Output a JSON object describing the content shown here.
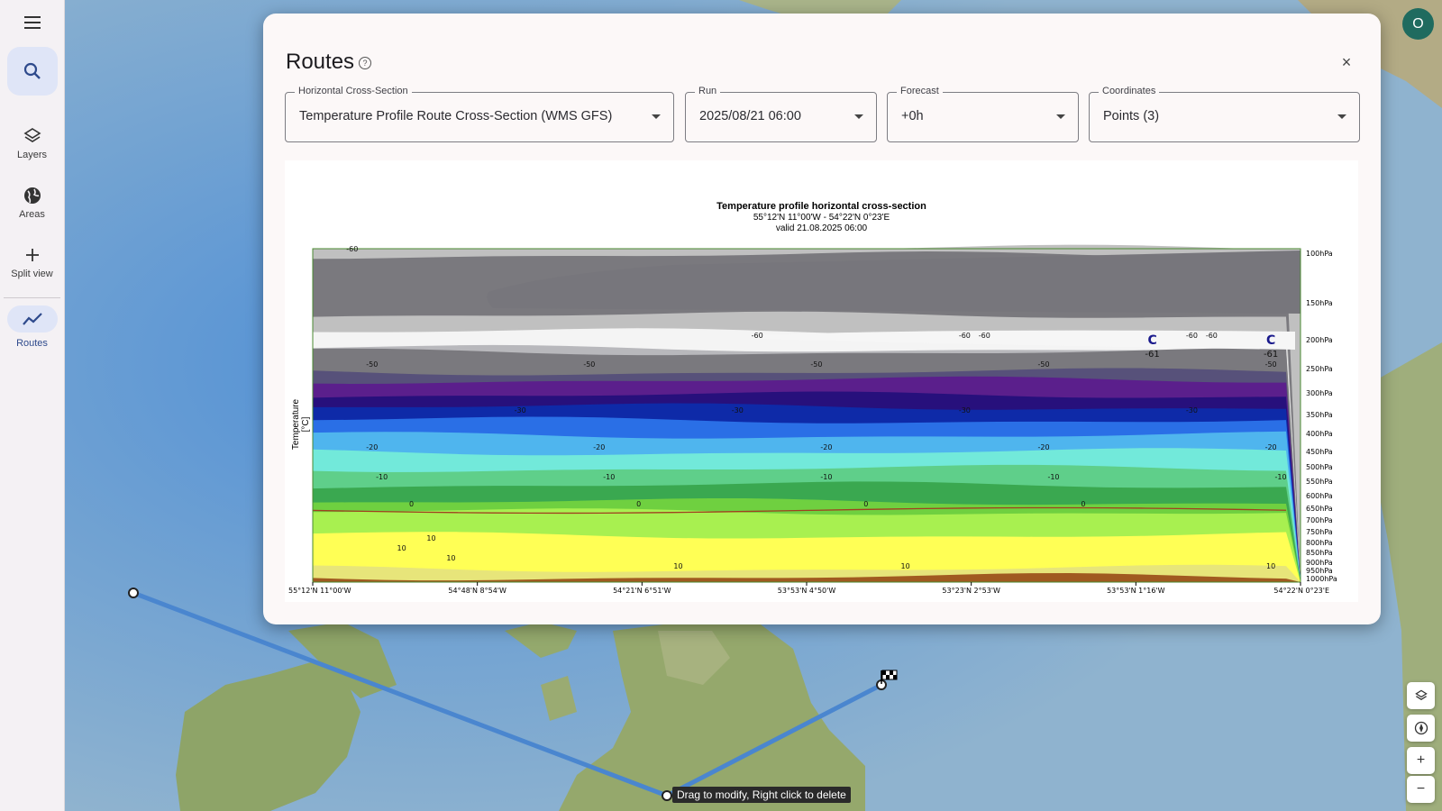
{
  "sidebar": {
    "items": [
      {
        "label": "Layers",
        "icon": "layers-icon"
      },
      {
        "label": "Areas",
        "icon": "globe-icon"
      },
      {
        "label": "Split view",
        "icon": "plus-icon"
      },
      {
        "label": "Routes",
        "icon": "route-chart-icon"
      }
    ]
  },
  "dialog": {
    "title": "Routes",
    "help_glyph": "?",
    "close_glyph": "×",
    "fields": [
      {
        "label": "Horizontal Cross-Section",
        "value": "Temperature Profile Route Cross-Section (WMS GFS)"
      },
      {
        "label": "Run",
        "value": "2025/08/21 06:00"
      },
      {
        "label": "Forecast",
        "value": "+0h"
      },
      {
        "label": "Coordinates",
        "value": "Points (3)"
      }
    ]
  },
  "chart_data": {
    "type": "heatmap",
    "title": "Temperature profile horizontal cross-section",
    "subtitle": "55°12'N 11°00'W - 54°22'N 0°23'E",
    "valid": "valid 21.08.2025 06:00",
    "ylabel": "Temperature\n[°C]",
    "x_tick_labels": [
      "55°12'N 11°00'W",
      "54°48'N 8°54'W",
      "54°21'N 6°51'W",
      "53°53'N 4°50'W",
      "53°23'N 2°53'W",
      "53°53'N 1°16'W",
      "54°22'N 0°23'E"
    ],
    "pressure_levels": [
      "100hPa",
      "150hPa",
      "200hPa",
      "250hPa",
      "300hPa",
      "350hPa",
      "400hPa",
      "450hPa",
      "500hPa",
      "550hPa",
      "600hPa",
      "650hPa",
      "700hPa",
      "750hPa",
      "800hPa",
      "850hPa",
      "900hPa",
      "950hPa",
      "1000hPa"
    ],
    "contour_labels": [
      {
        "level": 100,
        "px": 0.04,
        "label": "-60"
      },
      {
        "level": 250,
        "px": 0.06,
        "label": "-50"
      },
      {
        "level": 250,
        "px": 0.28,
        "label": "-50"
      },
      {
        "level": 250,
        "px": 0.51,
        "label": "-50"
      },
      {
        "level": 250,
        "px": 0.74,
        "label": "-50"
      },
      {
        "level": 250,
        "px": 0.97,
        "label": "-50"
      },
      {
        "level": 200,
        "px": 0.45,
        "label": "-60"
      },
      {
        "level": 200,
        "px": 0.66,
        "label": "-60"
      },
      {
        "level": 200,
        "px": 0.68,
        "label": "-60"
      },
      {
        "level": 200,
        "px": 0.89,
        "label": "-60"
      },
      {
        "level": 200,
        "px": 0.91,
        "label": "-60"
      },
      {
        "level": 350,
        "px": 0.21,
        "label": "-30"
      },
      {
        "level": 350,
        "px": 0.43,
        "label": "-30"
      },
      {
        "level": 350,
        "px": 0.66,
        "label": "-30"
      },
      {
        "level": 350,
        "px": 0.89,
        "label": "-30"
      },
      {
        "level": 450,
        "px": 0.06,
        "label": "-20"
      },
      {
        "level": 450,
        "px": 0.29,
        "label": "-20"
      },
      {
        "level": 450,
        "px": 0.52,
        "label": "-20"
      },
      {
        "level": 450,
        "px": 0.74,
        "label": "-20"
      },
      {
        "level": 450,
        "px": 0.97,
        "label": "-20"
      },
      {
        "level": 550,
        "px": 0.07,
        "label": "-10"
      },
      {
        "level": 550,
        "px": 0.3,
        "label": "-10"
      },
      {
        "level": 550,
        "px": 0.52,
        "label": "-10"
      },
      {
        "level": 550,
        "px": 0.75,
        "label": "-10"
      },
      {
        "level": 550,
        "px": 0.98,
        "label": "-10"
      },
      {
        "level": 650,
        "px": 0.1,
        "label": "0"
      },
      {
        "level": 650,
        "px": 0.33,
        "label": "0"
      },
      {
        "level": 650,
        "px": 0.56,
        "label": "0"
      },
      {
        "level": 650,
        "px": 0.78,
        "label": "0"
      },
      {
        "level": 800,
        "px": 0.12,
        "label": "10"
      },
      {
        "level": 850,
        "px": 0.09,
        "label": "10"
      },
      {
        "level": 900,
        "px": 0.14,
        "label": "10"
      },
      {
        "level": 950,
        "px": 0.37,
        "label": "10"
      },
      {
        "level": 950,
        "px": 0.6,
        "label": "10"
      },
      {
        "level": 950,
        "px": 0.97,
        "label": "10"
      }
    ],
    "cold_centers": [
      {
        "symbol": "C",
        "value": "-61",
        "px": 0.85
      },
      {
        "symbol": "C",
        "value": "-61",
        "px": 0.97
      }
    ]
  },
  "map": {
    "tooltip": "Drag to modify, Right click to delete",
    "avatar_letter": "O",
    "zoom_in": "+",
    "zoom_out": "−"
  }
}
